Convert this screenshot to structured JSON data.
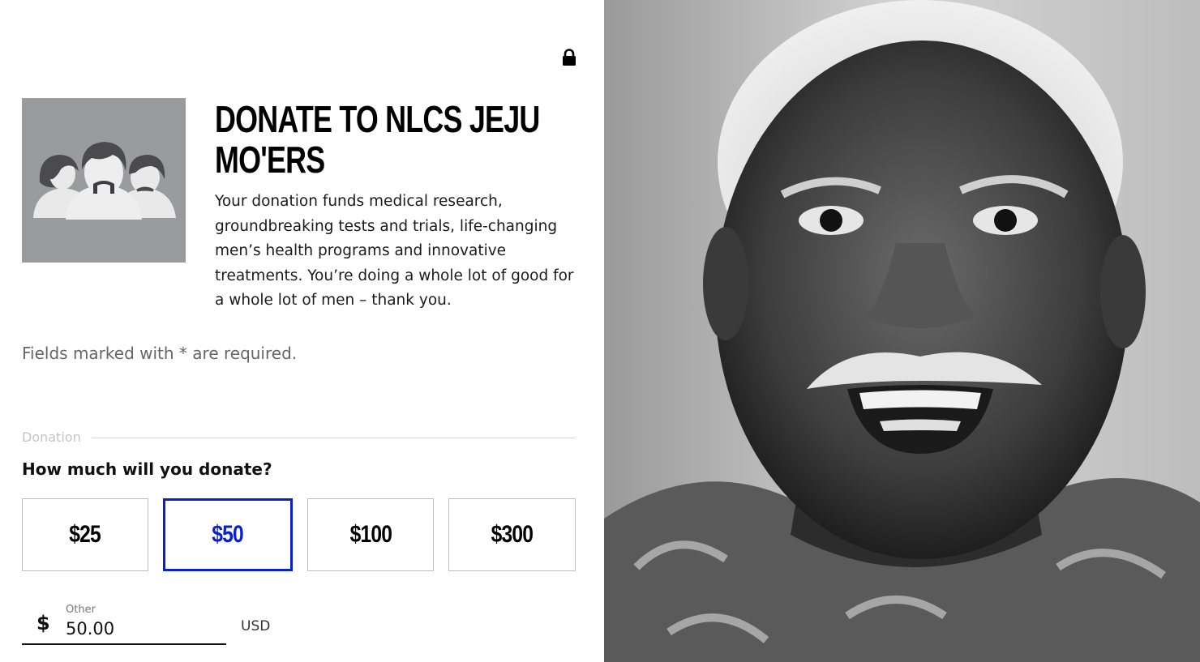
{
  "header": {
    "lock_icon": "lock-icon"
  },
  "campaign": {
    "logo_icon": "three-men-with-moustaches-icon",
    "title_line1": "DONATE TO NLCS JEJU",
    "title_line2": "MO'ERS",
    "description": "Your donation funds medical research, groundbreaking tests and trials, life-changing men’s health programs and innovative treatments. You’re doing a whole lot of good for a whole lot of men – thank you."
  },
  "form": {
    "required_note": "Fields marked with * are required.",
    "section_legend": "Donation",
    "question": "How much will you donate?",
    "amounts": [
      {
        "label": "$25",
        "selected": false
      },
      {
        "label": "$50",
        "selected": true
      },
      {
        "label": "$100",
        "selected": false
      },
      {
        "label": "$300",
        "selected": false
      }
    ],
    "other": {
      "currency_symbol": "$",
      "label": "Other",
      "value": "50.00",
      "currency_code": "USD"
    }
  },
  "colors": {
    "accent": "#0a1fd1",
    "logo_tile": "#9a9b9f",
    "border": "#bdbdbd"
  },
  "hero": {
    "image_subject": "black-and-white-portrait-smiling-man-with-moustache"
  }
}
